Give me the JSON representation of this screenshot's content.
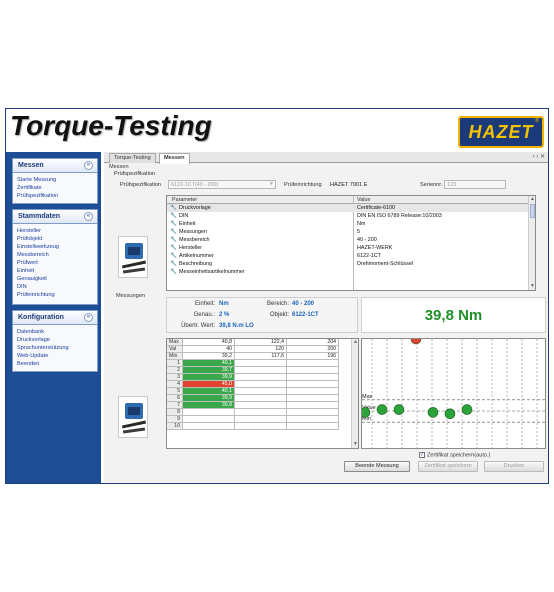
{
  "app": {
    "title": "Torque-Testing",
    "logo": "HAZET",
    "logo_mark": "®"
  },
  "sidebar": {
    "panels": [
      {
        "title": "Messen",
        "items": [
          "Starte Messung",
          "Zertifikate",
          "Prüfspezifikation"
        ]
      },
      {
        "title": "Stammdaten",
        "items": [
          "Hersteller",
          "Prüfobjekt",
          "Einstellwerkzeug",
          "Messbereich",
          "Prüfwert",
          "Einheit",
          "Genauigkeit",
          "DIN",
          "Prüfeinrichtung"
        ]
      },
      {
        "title": "Konfiguration",
        "items": [
          "Datenbank",
          "Druckvorlage",
          "Sprachunterstützung",
          "Web-Update",
          "Beenden"
        ]
      }
    ],
    "collapse_glyph": "«"
  },
  "tabs": [
    {
      "label": "Torque-Testing",
      "active": false
    },
    {
      "label": "Messen",
      "active": true
    }
  ],
  "tab_controls": "‹ › ✕",
  "spec": {
    "section_messen": "Messen",
    "section_pruefspez": "Prüfspezifikation",
    "spec_label": "Prüfspezifikation",
    "spec_value": "6122-1CT(40 - 200)",
    "device_label": "Prüfeinrichtung",
    "device_value": "HAZET 7901 E",
    "series_label": "Seriennr.",
    "series_value": "123"
  },
  "parameters": {
    "headers": [
      "Parameter",
      "Value"
    ],
    "rows": [
      {
        "name": "Druckvorlage",
        "value": "Certificate-6100"
      },
      {
        "name": "DIN",
        "value": "DIN EN ISO 6789 Release:10/2003"
      },
      {
        "name": "Einheit",
        "value": "Nm"
      },
      {
        "name": "Messungen",
        "value": "5"
      },
      {
        "name": "Messbereich",
        "value": "40 - 200"
      },
      {
        "name": "Hersteller",
        "value": "HAZET-WERK"
      },
      {
        "name": "Artikelnummer",
        "value": "6122-1CT"
      },
      {
        "name": "Beschreibung",
        "value": "Drehmoment-Schlüssel"
      },
      {
        "name": "Messeinheitsartikelnummer",
        "value": ""
      }
    ]
  },
  "measurements": {
    "section_label": "Messungen",
    "einheit_label": "Einheit:",
    "einheit_value": "Nm",
    "bereich_label": "Bereich:",
    "bereich_value": "40 - 200",
    "genau_label": "Genau.:",
    "genau_value": "2 %",
    "objekt_label": "Objekt:",
    "objekt_value": "6122-1CT",
    "uebertr_label": "Übertr. Wert:",
    "uebertr_value": "39,8 N.m LO",
    "current_reading": "39,8 Nm"
  },
  "grid": {
    "summary": [
      {
        "label": "Max",
        "cols": [
          "40,8",
          "122,4",
          "204"
        ]
      },
      {
        "label": "Val",
        "cols": [
          "40",
          "120",
          "200"
        ]
      },
      {
        "label": "Min",
        "cols": [
          "39,2",
          "117,6",
          "196"
        ]
      }
    ],
    "rows": [
      {
        "index": "1",
        "value": "40,1",
        "status": "ok"
      },
      {
        "index": "2",
        "value": "39,7",
        "status": "ok"
      },
      {
        "index": "3",
        "value": "39,9",
        "status": "ok"
      },
      {
        "index": "4",
        "value": "45,0",
        "status": "bad"
      },
      {
        "index": "5",
        "value": "40,1",
        "status": "ok"
      },
      {
        "index": "6",
        "value": "39,9",
        "status": "ok"
      },
      {
        "index": "7",
        "value": "39,8",
        "status": "ok"
      },
      {
        "index": "8",
        "value": "",
        "status": "empty"
      },
      {
        "index": "9",
        "value": "",
        "status": "empty"
      },
      {
        "index": "10",
        "value": "",
        "status": "empty"
      }
    ]
  },
  "chart_data": {
    "type": "scatter",
    "title": "",
    "xlabel": "",
    "ylabel": "",
    "reference_lines": [
      {
        "label": "Max",
        "value": 40.8
      },
      {
        "label": "Value",
        "value": 40
      },
      {
        "label": "Min",
        "value": 39.2
      }
    ],
    "series": [
      {
        "values": [
          39.9,
          40.1,
          40.1,
          39.9,
          39.8,
          40.1,
          45.0
        ]
      }
    ],
    "x": [
      1,
      2,
      3,
      5,
      6,
      7,
      4
    ],
    "colors": {
      "ok": "#2aa33a",
      "bad": "#e0432f"
    }
  },
  "footer": {
    "autosave_label": "Zertifikat speichern(auto.)",
    "autosave_checked": true,
    "finish_button": "Beende Messung",
    "save_cert_button": "Zertifikat speichern",
    "print_button": "Drucken"
  }
}
